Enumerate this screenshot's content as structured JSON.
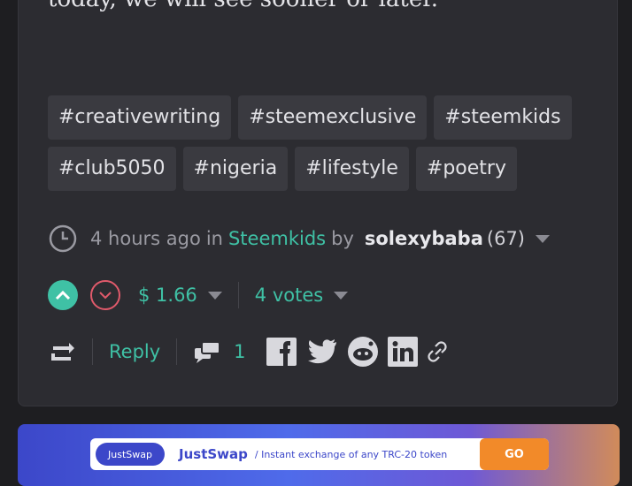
{
  "post": {
    "body_tail": "today, we will see sooner or later."
  },
  "tags": [
    "#creativewriting",
    "#steemexclusive",
    "#steemkids",
    "#club5050",
    "#nigeria",
    "#lifestyle",
    "#poetry"
  ],
  "meta": {
    "time": "4 hours ago",
    "in_word": "in",
    "community": "Steemkids",
    "by_word": "by",
    "author": "solexybaba",
    "reputation": "(67)"
  },
  "voting": {
    "payout": "$ 1.66",
    "votes": "4 votes"
  },
  "actions": {
    "reply": "Reply",
    "comment_count": "1"
  },
  "banner": {
    "logo": "JustSwap",
    "name": "JustSwap",
    "tagline": "/ Instant exchange of any TRC-20 token",
    "cta": "GO"
  },
  "colors": {
    "accent": "#3fc1a5",
    "downvote": "#e05a6b",
    "card": "#2c2c31",
    "banner_cta": "#f28a29"
  }
}
